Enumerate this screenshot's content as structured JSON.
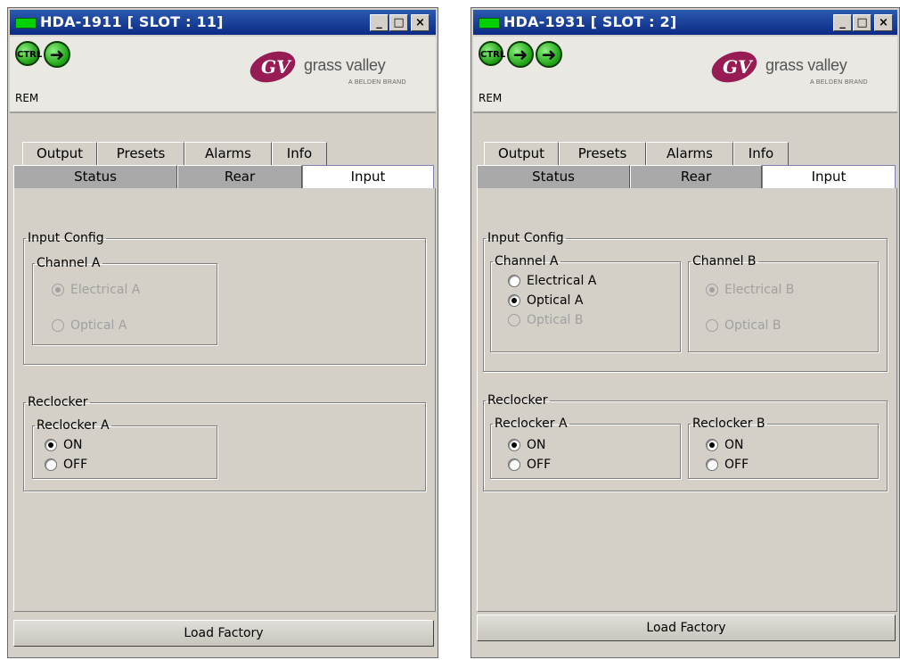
{
  "windows": [
    {
      "title": "HDA-1911 [ SLOT : 11]",
      "ctrl_label": "CTRL",
      "rem_label": "REM",
      "logo": {
        "brand": "grass valley",
        "tagline": "A BELDEN BRAND"
      },
      "tabs_row1": [
        "Output",
        "Presets",
        "Alarms",
        "Info"
      ],
      "tabs_row2": [
        "Status",
        "Rear",
        "Input"
      ],
      "input_config": {
        "label": "Input Config",
        "channels": [
          {
            "label": "Channel A",
            "options": [
              {
                "label": "Electrical A"
              },
              {
                "label": "Optical A"
              }
            ]
          }
        ]
      },
      "reclocker": {
        "label": "Reclocker",
        "groups": [
          {
            "label": "Reclocker A",
            "options": [
              {
                "label": "ON"
              },
              {
                "label": "OFF"
              }
            ]
          }
        ]
      },
      "load_factory": "Load Factory"
    },
    {
      "title": "HDA-1931 [ SLOT : 2]",
      "ctrl_label": "CTRL",
      "rem_label": "REM",
      "logo": {
        "brand": "grass valley",
        "tagline": "A BELDEN BRAND"
      },
      "tabs_row1": [
        "Output",
        "Presets",
        "Alarms",
        "Info"
      ],
      "tabs_row2": [
        "Status",
        "Rear",
        "Input"
      ],
      "input_config": {
        "label": "Input Config",
        "channels": [
          {
            "label": "Channel A",
            "options": [
              {
                "label": "Electrical A"
              },
              {
                "label": "Optical A"
              },
              {
                "label": "Optical B"
              }
            ]
          },
          {
            "label": "Channel B",
            "options": [
              {
                "label": "Electrical B"
              },
              {
                "label": "Optical B"
              }
            ]
          }
        ]
      },
      "reclocker": {
        "label": "Reclocker",
        "groups": [
          {
            "label": "Reclocker A",
            "options": [
              {
                "label": "ON"
              },
              {
                "label": "OFF"
              }
            ]
          },
          {
            "label": "Reclocker B",
            "options": [
              {
                "label": "ON"
              },
              {
                "label": "OFF"
              }
            ]
          }
        ]
      },
      "load_factory": "Load Factory"
    }
  ],
  "title_buttons": [
    "_",
    "□",
    "×"
  ],
  "colors": {
    "titlebar": "#0b2a85",
    "status_indicator": "#00d000",
    "logo_red": "#c8102e",
    "logo_purple": "#5a2a82"
  }
}
